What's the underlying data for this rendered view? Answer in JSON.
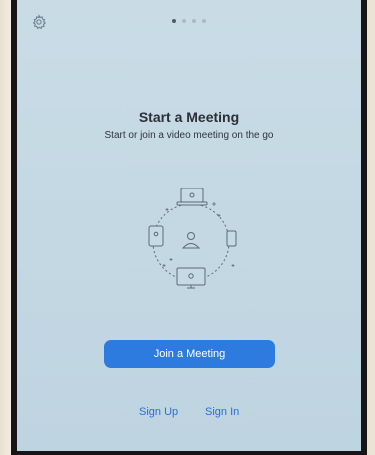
{
  "header": {
    "settings_icon": "gear-icon",
    "pager": {
      "total": 4,
      "active_index": 0
    }
  },
  "hero": {
    "title": "Start a Meeting",
    "subtitle": "Start or join a video meeting on the go",
    "illustration_icon": "meeting-devices-illustration"
  },
  "actions": {
    "join_label": "Join a Meeting",
    "sign_up_label": "Sign Up",
    "sign_in_label": "Sign In"
  },
  "colors": {
    "primary": "#2e7be0",
    "link": "#2b6fd1",
    "screen_bg": "#c5d9e4"
  }
}
